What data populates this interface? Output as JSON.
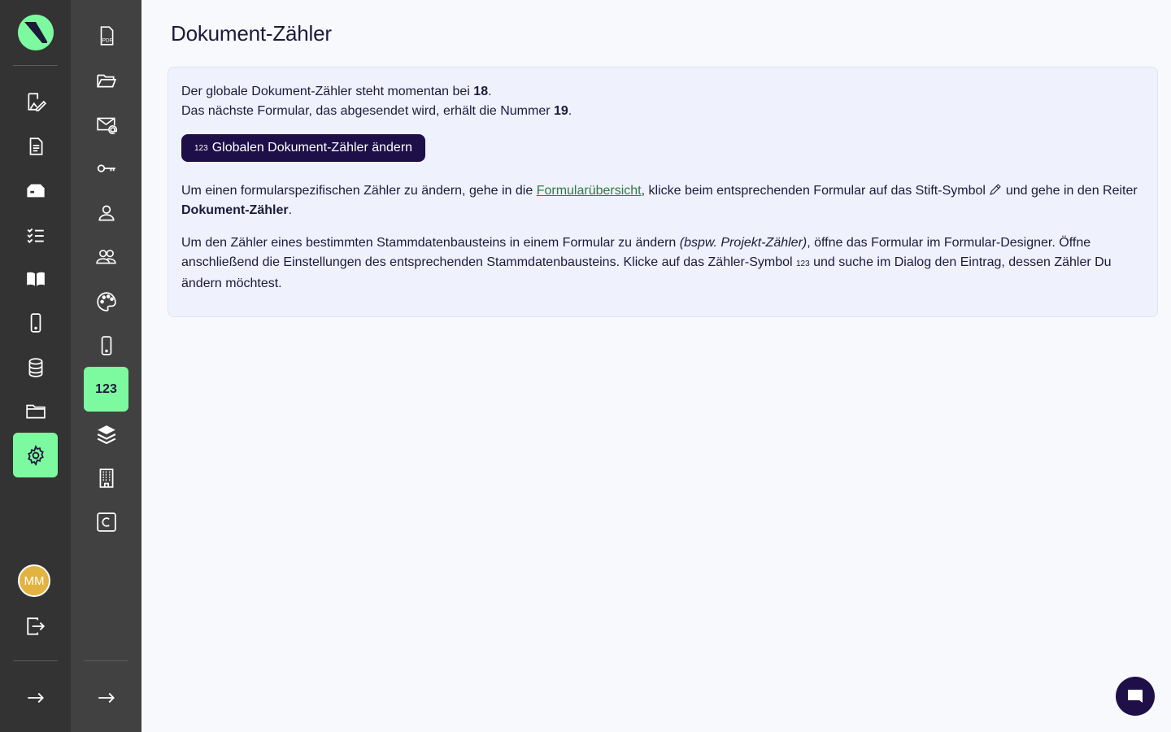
{
  "sidebar": {
    "avatar_initials": "MM",
    "items": [
      {
        "icon": "edit-form-icon"
      },
      {
        "icon": "document-icon"
      },
      {
        "icon": "inbox-icon"
      },
      {
        "icon": "checklist-icon"
      },
      {
        "icon": "book-icon"
      },
      {
        "icon": "mobile-icon"
      },
      {
        "icon": "database-icon"
      },
      {
        "icon": "folder-icon"
      },
      {
        "icon": "settings-icon",
        "active": true
      }
    ]
  },
  "subnav": {
    "counter_label": "123",
    "items": [
      {
        "icon": "pdf-icon"
      },
      {
        "icon": "folder-open-icon"
      },
      {
        "icon": "mail-at-icon"
      },
      {
        "icon": "key-icon"
      },
      {
        "icon": "user-icon"
      },
      {
        "icon": "users-icon"
      },
      {
        "icon": "palette-icon"
      },
      {
        "icon": "mobile-icon"
      },
      {
        "icon": "counter-icon",
        "active": true
      },
      {
        "icon": "layers-icon"
      },
      {
        "icon": "building-icon"
      },
      {
        "icon": "copyright-icon"
      }
    ]
  },
  "page": {
    "title": "Dokument-Zähler",
    "line1_prefix": "Der globale Dokument-Zähler steht momentan bei ",
    "current_count": "18",
    "line2_prefix": "Das nächste Formular, das abgesendet wird, erhält die Nummer ",
    "next_number": "19",
    "period": ".",
    "button": {
      "icon_text": "123",
      "label": "Globalen Dokument-Zähler ändern"
    },
    "para2": {
      "before_link": "Um einen formularspezifischen Zähler zu ändern, gehe in die ",
      "link": "Formularübersicht",
      "after_link": ", klicke beim entsprechenden Formular auf das Stift-Symbol ",
      "after_icon": " und gehe in den Reiter ",
      "bold": "Dokument-Zähler"
    },
    "para3": {
      "before_italic": "Um den Zähler eines bestimmten Stammdatenbausteins in einem Formular zu ändern ",
      "italic": "(bspw. Projekt-Zähler)",
      "after_italic": ", öffne das Formular im Formular-Designer. Öffne anschließend die Einstellungen des entsprechenden Stammdatenbausteins. Klicke auf das Zähler-Symbol ",
      "icon_text": "123",
      "after_icon": " und suche im Dialog den Eintrag, dessen Zähler Du ändern möchtest."
    }
  },
  "colors": {
    "accent": "#7dfa9f",
    "primary": "#1e0f48",
    "link": "#2f7a40",
    "rail": "#333333",
    "subrail": "#414141"
  }
}
